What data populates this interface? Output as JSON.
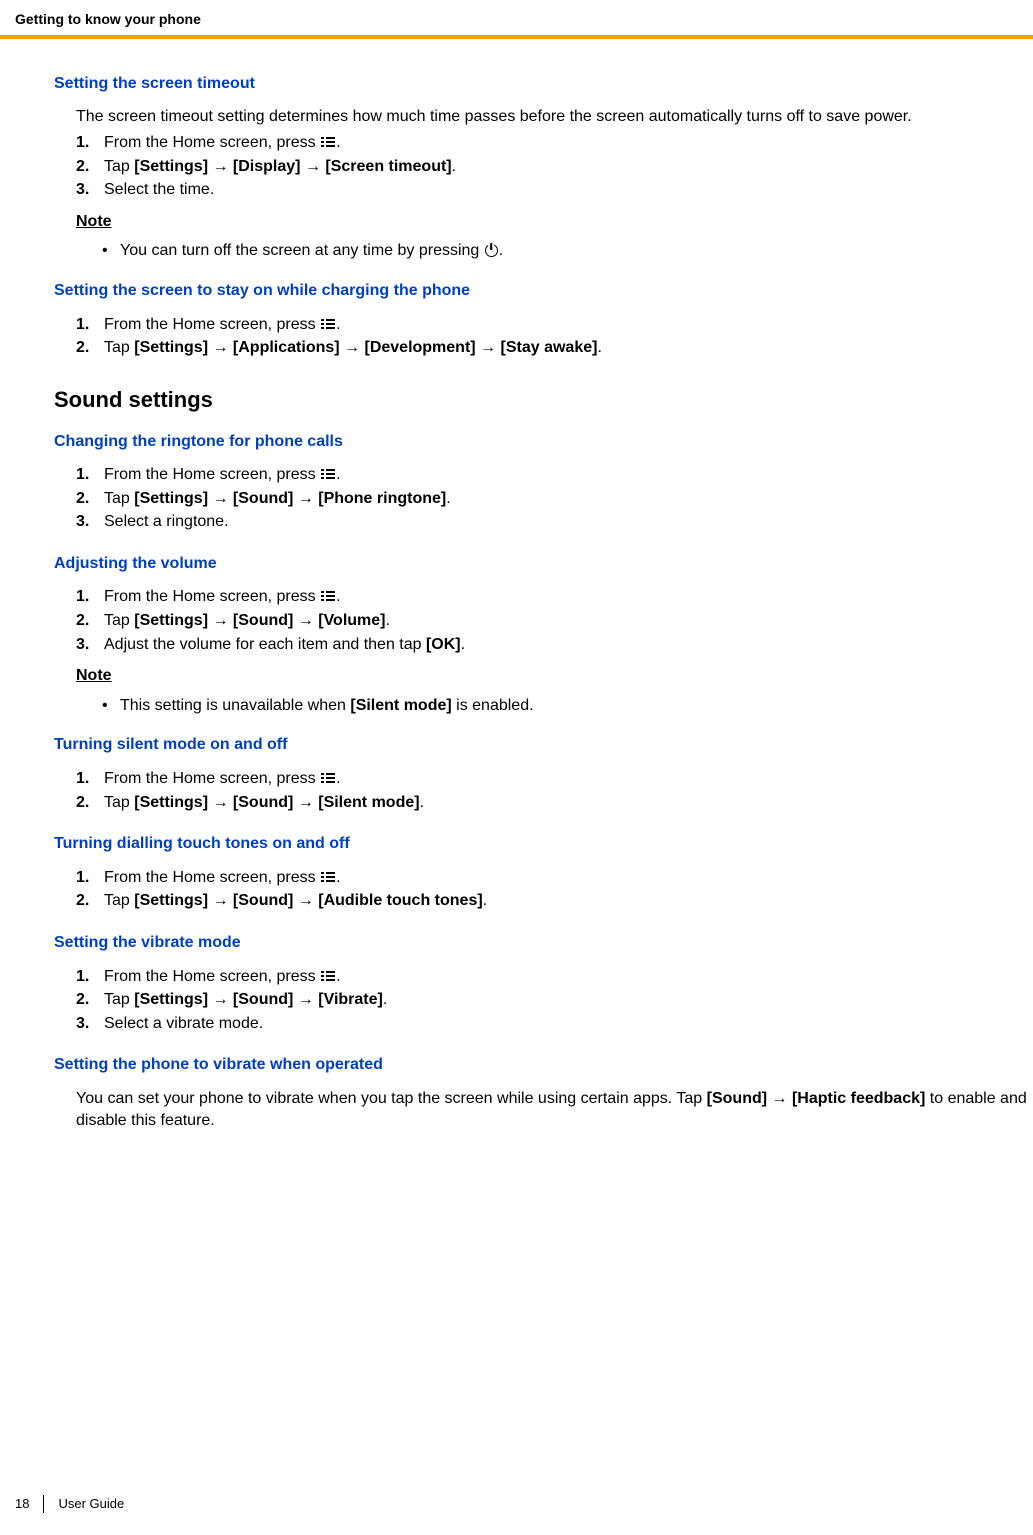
{
  "runningHead": "Getting to know your phone",
  "sections": {
    "screenTimeout": {
      "title": "Setting the screen timeout",
      "intro": "The screen timeout setting determines how much time passes before the screen automatically turns off to save power.",
      "steps": [
        {
          "num": "1.",
          "pre": "From the Home screen, press ",
          "icon": "menu",
          "post": "."
        },
        {
          "num": "2.",
          "html": "Tap <b>[Settings]</b> → <b>[Display]</b> → <b>[Screen timeout]</b>."
        },
        {
          "num": "3.",
          "text": "Select the time."
        }
      ],
      "noteLabel": "Note",
      "notes": [
        {
          "pre": "You can turn off the screen at any time by pressing ",
          "icon": "power",
          "post": "."
        }
      ]
    },
    "stayOn": {
      "title": "Setting the screen to stay on while charging the phone",
      "steps": [
        {
          "num": "1.",
          "pre": "From the Home screen, press ",
          "icon": "menu",
          "post": "."
        },
        {
          "num": "2.",
          "html": "Tap <b>[Settings]</b> → <b>[Applications]</b> → <b>[Development]</b> → <b>[Stay awake]</b>."
        }
      ]
    },
    "soundHeading": "Sound settings",
    "ringtone": {
      "title": "Changing the ringtone for phone calls",
      "steps": [
        {
          "num": "1.",
          "pre": "From the Home screen, press ",
          "icon": "menu",
          "post": "."
        },
        {
          "num": "2.",
          "html": "Tap <b>[Settings]</b> → <b>[Sound]</b> → <b>[Phone ringtone]</b>."
        },
        {
          "num": "3.",
          "text": "Select a ringtone."
        }
      ]
    },
    "volume": {
      "title": "Adjusting the volume",
      "steps": [
        {
          "num": "1.",
          "pre": "From the Home screen, press ",
          "icon": "menu",
          "post": "."
        },
        {
          "num": "2.",
          "html": "Tap <b>[Settings]</b> → <b>[Sound]</b> → <b>[Volume]</b>."
        },
        {
          "num": "3.",
          "html": "Adjust the volume for each item and then tap <b>[OK]</b>."
        }
      ],
      "noteLabel": "Note",
      "notes": [
        {
          "html": "This setting is unavailable when <b>[Silent mode]</b> is enabled."
        }
      ]
    },
    "silent": {
      "title": "Turning silent mode on and off",
      "steps": [
        {
          "num": "1.",
          "pre": "From the Home screen, press ",
          "icon": "menu",
          "post": "."
        },
        {
          "num": "2.",
          "html": "Tap <b>[Settings]</b> → <b>[Sound]</b> → <b>[Silent mode]</b>."
        }
      ]
    },
    "touchTones": {
      "title": "Turning dialling touch tones on and off",
      "steps": [
        {
          "num": "1.",
          "pre": "From the Home screen, press ",
          "icon": "menu",
          "post": "."
        },
        {
          "num": "2.",
          "html": "Tap <b>[Settings]</b> → <b>[Sound]</b> → <b>[Audible touch tones]</b>."
        }
      ]
    },
    "vibrate": {
      "title": "Setting the vibrate mode",
      "steps": [
        {
          "num": "1.",
          "pre": "From the Home screen, press ",
          "icon": "menu",
          "post": "."
        },
        {
          "num": "2.",
          "html": "Tap <b>[Settings]</b> → <b>[Sound]</b> → <b>[Vibrate]</b>."
        },
        {
          "num": "3.",
          "text": "Select a vibrate mode."
        }
      ]
    },
    "haptic": {
      "title": "Setting the phone to vibrate when operated",
      "paraHtml": "You can set your phone to vibrate when you tap the screen while using certain apps. Tap <b>[Sound]</b> → <b>[Haptic feedback]</b> to enable and disable this feature."
    }
  },
  "footer": {
    "page": "18",
    "label": "User Guide"
  }
}
